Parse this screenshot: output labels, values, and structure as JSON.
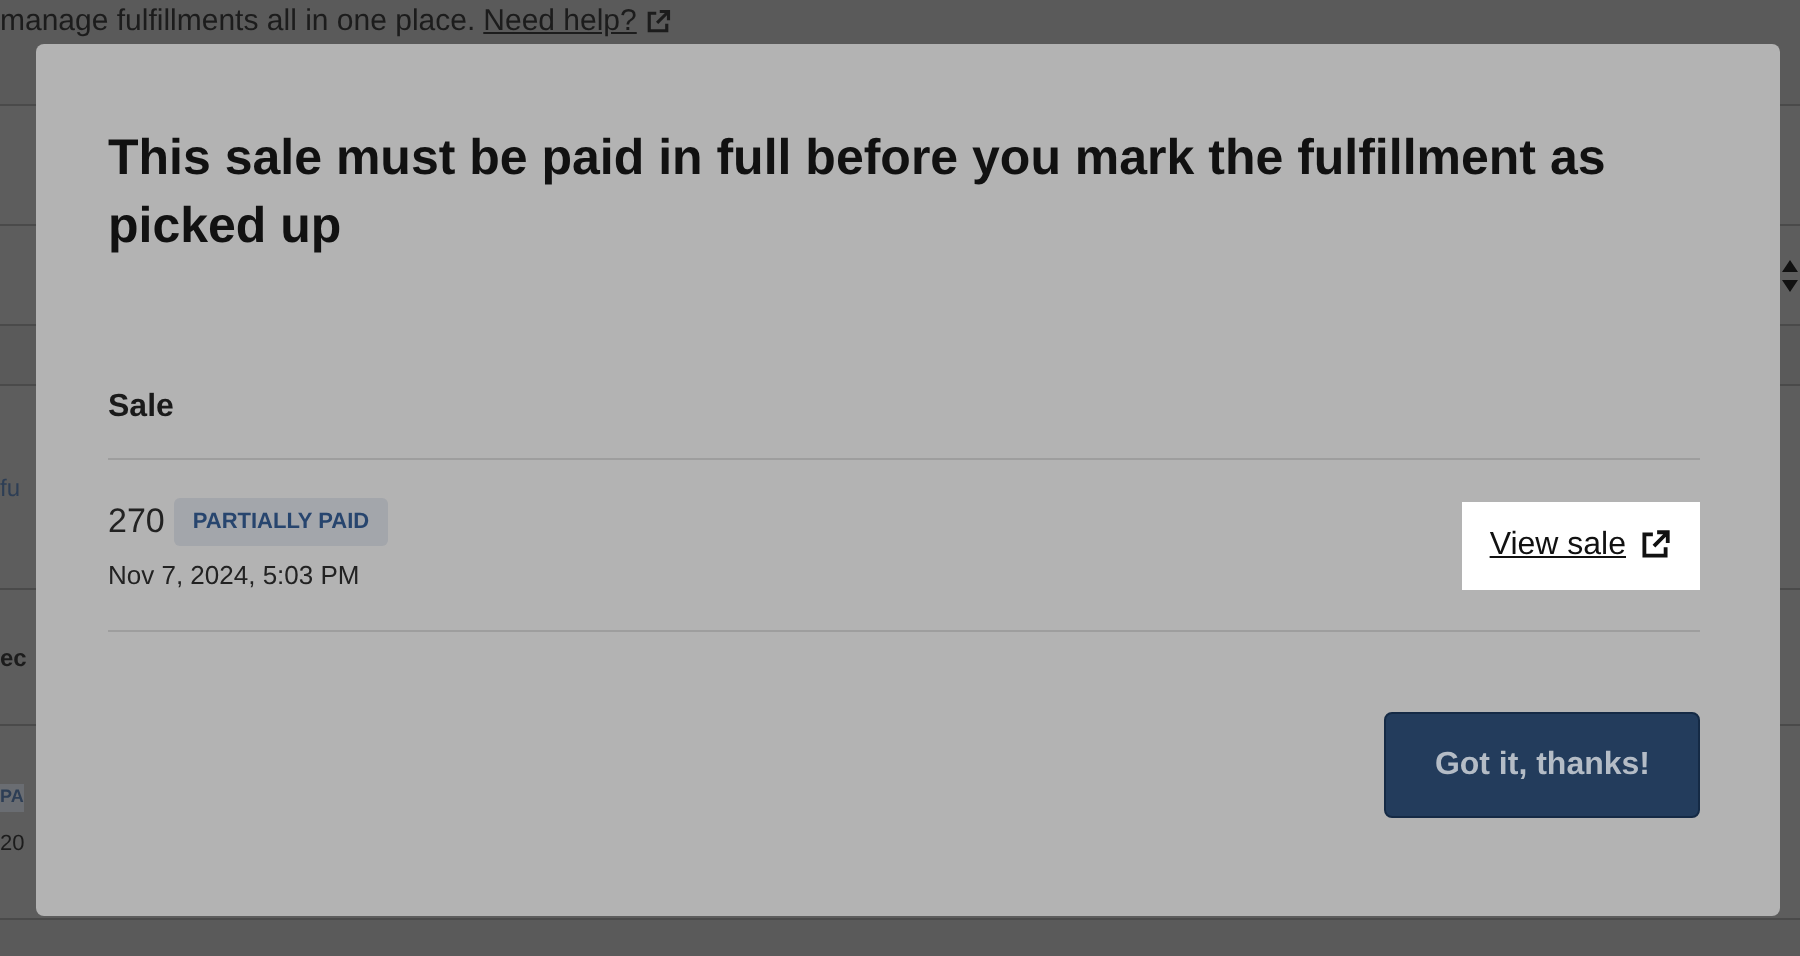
{
  "background": {
    "intro": "manage fulfillments all in one place.",
    "help_link": "Need help?",
    "fragments": [
      "fu",
      "ec",
      "PA",
      "20"
    ]
  },
  "dialog": {
    "title": "This sale must be paid in full before you mark the fulfillment as picked up",
    "column": "Sale",
    "sale": {
      "number": "270",
      "status": "PARTIALLY PAID",
      "date": "Nov 7, 2024, 5:03 PM",
      "link": "View sale"
    },
    "button": "Got it, thanks!"
  }
}
